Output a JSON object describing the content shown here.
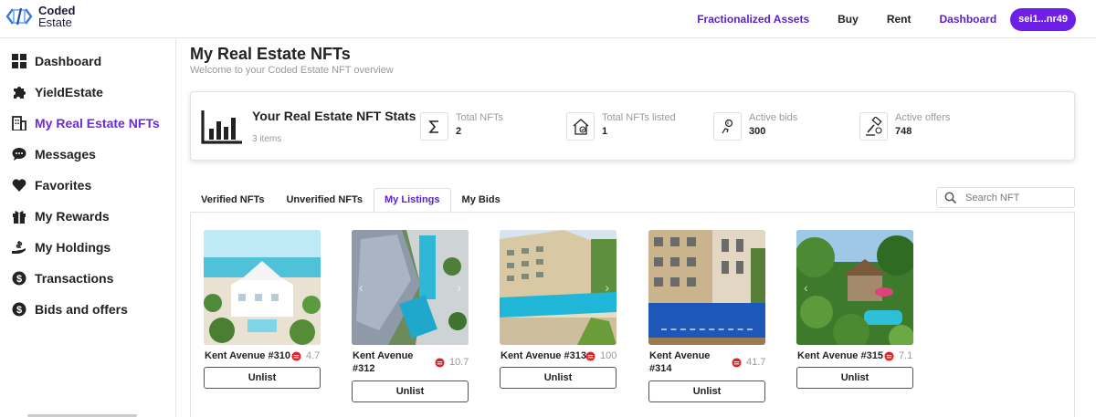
{
  "app": {
    "logo_line1": "Coded",
    "logo_line2": "Estate"
  },
  "nav": {
    "items": [
      {
        "label": "Fractionalized Assets"
      },
      {
        "label": "Buy"
      },
      {
        "label": "Rent"
      },
      {
        "label": "Dashboard"
      }
    ],
    "wallet": "sei1...nr49"
  },
  "sidebar": {
    "items": [
      {
        "label": "Dashboard",
        "icon": "grid-icon"
      },
      {
        "label": "YieldEstate",
        "icon": "puzzle-icon"
      },
      {
        "label": "My Real Estate NFTs",
        "icon": "building-icon",
        "active": true
      },
      {
        "label": "Messages",
        "icon": "chat-bubble-icon"
      },
      {
        "label": "Favorites",
        "icon": "heart-icon"
      },
      {
        "label": "My Rewards",
        "icon": "gift-icon"
      },
      {
        "label": "My Holdings",
        "icon": "hand-coin-icon"
      },
      {
        "label": "Transactions",
        "icon": "dollar-coin-icon"
      },
      {
        "label": "Bids and offers",
        "icon": "dollar-coin-icon"
      }
    ]
  },
  "header": {
    "title": "My Real Estate NFTs",
    "subtitle": "Welcome to your Coded Estate NFT overview"
  },
  "stats": {
    "title": "Your Real Estate NFT Stats",
    "count": "3 items",
    "items": [
      {
        "label": "Total NFTs",
        "value": "2",
        "icon": "sigma-icon"
      },
      {
        "label": "Total NFTs listed",
        "value": "1",
        "icon": "house-listed-icon"
      },
      {
        "label": "Active bids",
        "value": "300",
        "icon": "bid-hand-icon"
      },
      {
        "label": "Active offers",
        "value": "748",
        "icon": "auction-gavel-icon"
      }
    ]
  },
  "tabs": [
    {
      "label": "Verified NFTs"
    },
    {
      "label": "Unverified NFTs"
    },
    {
      "label": "My Listings",
      "active": true
    },
    {
      "label": "My Bids"
    }
  ],
  "search": {
    "placeholder": "Search NFT"
  },
  "cards": [
    {
      "name": "Kent Avenue #310",
      "price": "4.7",
      "button": "Unlist"
    },
    {
      "name": "Kent Avenue #312",
      "price": "10.7",
      "button": "Unlist"
    },
    {
      "name": "Kent Avenue #313",
      "price": "100",
      "button": "Unlist"
    },
    {
      "name": "Kent Avenue #314",
      "price": "41.7",
      "button": "Unlist"
    },
    {
      "name": "Kent Avenue #315",
      "price": "7.1",
      "button": "Unlist"
    }
  ],
  "colors": {
    "accent": "#6d1fe6",
    "accent_text": "#5a1fd1",
    "coin": "#d8262b"
  }
}
